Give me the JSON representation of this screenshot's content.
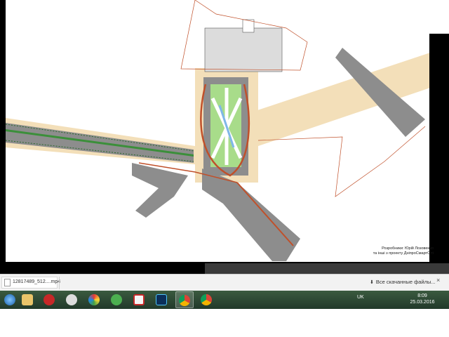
{
  "plan": {
    "credits_line1": "Розробники: Юрій Лозовенко",
    "credits_line2": "та інші з проекту ДніпроСмартСіті"
  },
  "download_bar": {
    "file_name": "12817489_512....mp4",
    "all_downloads": "Все скачанные файлы...",
    "close": "×"
  },
  "taskbar": {
    "apps": [
      "start",
      "explorer",
      "app-red",
      "media",
      "paint",
      "utorrent",
      "pdf",
      "photoshop",
      "chrome",
      "chrome-2"
    ],
    "lang": "UK",
    "time": "8:09",
    "date": "25.03.2016"
  },
  "colors": {
    "road": "#8d8d8d",
    "median": "#3b8f3a",
    "bike_lane": "#c0502a",
    "pedestrian": "#f3dfb9",
    "plaza": "#a8dc8a",
    "water": "#7fb7e8"
  }
}
